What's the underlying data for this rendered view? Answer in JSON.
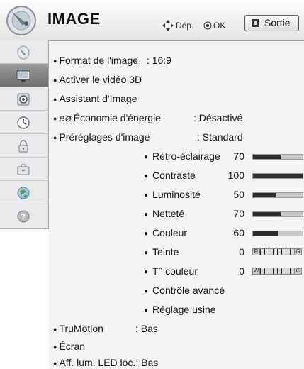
{
  "header": {
    "title": "IMAGE",
    "move_hint": "Dép.",
    "ok_hint": "OK",
    "exit_label": "Sortie"
  },
  "sidebar": {
    "items": [
      {
        "icon": "satellite-dish-icon",
        "active": false
      },
      {
        "icon": "tv-screen-icon",
        "active": true
      },
      {
        "icon": "speaker-icon",
        "active": false
      },
      {
        "icon": "clock-icon",
        "active": false
      },
      {
        "icon": "lock-icon",
        "active": false
      },
      {
        "icon": "options-suitcase-icon",
        "active": false
      },
      {
        "icon": "network-globe-icon",
        "active": false
      },
      {
        "icon": "help-icon",
        "active": false
      }
    ]
  },
  "menu": {
    "picture_format": {
      "label": "Format de l'image",
      "value": ": 16:9"
    },
    "enable_3d": {
      "label": "Activer le vidéo 3D"
    },
    "picture_wizard": {
      "label": "Assistant d'Image"
    },
    "energy_saving": {
      "icon_text": "e⌀",
      "label": "Économie d'énergie",
      "value": ": Désactivé"
    },
    "picture_mode": {
      "label": "Préréglages d'image",
      "value": ": Standard"
    },
    "trumotion": {
      "label": "TruMotion",
      "value": ": Bas"
    },
    "screen": {
      "label": "Écran"
    },
    "led_local_dimming": {
      "label": "Aff. lum. LED loc.: Bas"
    }
  },
  "adjustments": [
    {
      "label": "Rétro-éclairage",
      "value": "70",
      "level": 0.55
    },
    {
      "label": "Contraste",
      "value": "100",
      "level": 1.0
    },
    {
      "label": "Luminosité",
      "value": "50",
      "level": 0.45
    },
    {
      "label": "Netteté",
      "value": "70",
      "level": 0.55
    },
    {
      "label": "Couleur",
      "value": "60",
      "level": 0.5
    },
    {
      "label": "Teinte",
      "value": "0",
      "scale_left": "R",
      "scale_right": "G"
    },
    {
      "label": "T° couleur",
      "value": "0",
      "scale_left": "W",
      "scale_right": "C"
    },
    {
      "label": "Contrôle avancé"
    },
    {
      "label": "Réglage usine"
    }
  ]
}
